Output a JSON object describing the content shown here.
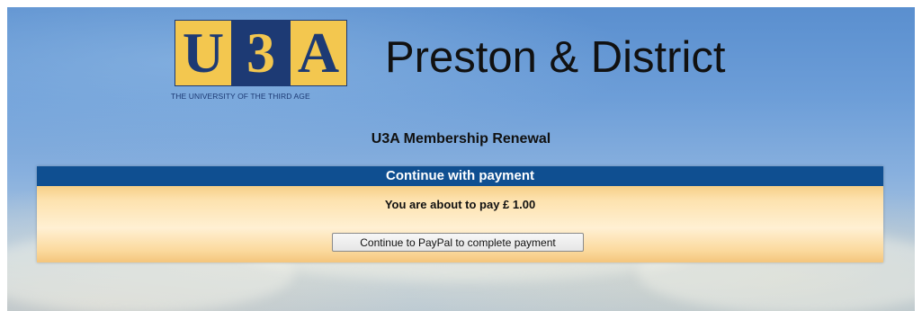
{
  "header": {
    "logo": {
      "letters": [
        "U",
        "3",
        "A"
      ],
      "tagline": "THE UNIVERSITY OF THE THIRD AGE",
      "colors": {
        "yellow": "#f3c74f",
        "navy": "#1d3a74"
      }
    },
    "site_title": "Preston & District"
  },
  "main": {
    "page_heading": "U3A Membership Renewal",
    "panel": {
      "title": "Continue with payment",
      "message": "You are about to pay £ 1.00",
      "button_label": "Continue to PayPal to complete payment"
    }
  },
  "colors": {
    "panel_header": "#0f4f91",
    "panel_body": "#fde2ae"
  }
}
